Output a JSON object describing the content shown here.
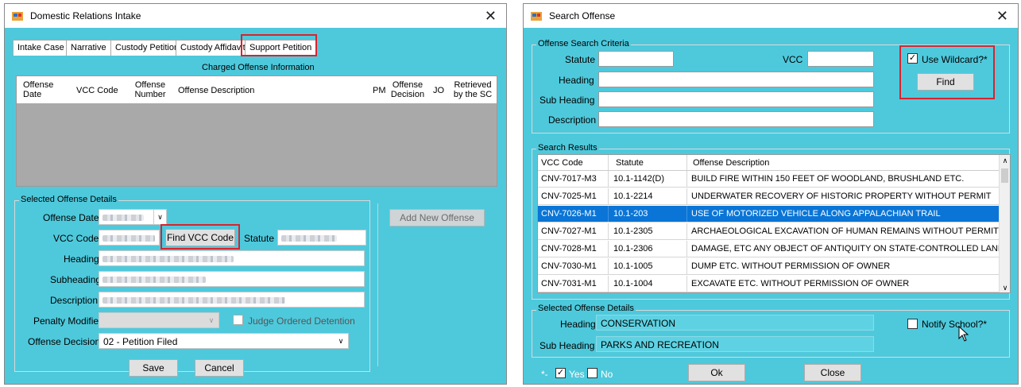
{
  "left_window": {
    "title": "Domestic Relations Intake",
    "tabs": [
      "Intake Case",
      "Narrative",
      "Custody Petition",
      "Custody Affidavit",
      "Support Petition"
    ],
    "grid_title": "Charged Offense Information",
    "columns": [
      "Offense Date",
      "VCC Code",
      "Offense Number",
      "Offense Description",
      "PM",
      "Offense Decision",
      "JO",
      "Retrieved by the SC"
    ],
    "details_group": "Selected Offense Details",
    "labels": {
      "offense_date": "Offense Date",
      "vcc_code": "VCC Code",
      "statute": "Statute",
      "heading": "Heading",
      "subheading": "Subheading",
      "description": "Description",
      "penalty_modifier": "Penalty Modifier",
      "judge_ordered": "Judge Ordered Detention",
      "offense_decision": "Offense Decision"
    },
    "find_vcc_button": "Find VCC Code",
    "add_offense_button": "Add New Offense",
    "offense_decision_value": "02 - Petition Filed",
    "save_button": "Save",
    "cancel_button": "Cancel"
  },
  "right_window": {
    "title": "Search Offense",
    "criteria_group": "Offense Search Criteria",
    "labels": {
      "statute": "Statute",
      "vcc": "VCC",
      "heading": "Heading",
      "sub_heading": "Sub Heading",
      "description": "Description"
    },
    "use_wildcard": "Use Wildcard?*",
    "find_button": "Find",
    "results_group": "Search Results",
    "result_columns": [
      "VCC Code",
      "Statute",
      "Offense Description"
    ],
    "results": [
      {
        "vcc": "CNV-7017-M3",
        "statute": "10.1-1142(D)",
        "desc": "BUILD FIRE WITHIN 150 FEET OF WOODLAND, BRUSHLAND ETC."
      },
      {
        "vcc": "CNV-7025-M1",
        "statute": "10.1-2214",
        "desc": "UNDERWATER RECOVERY OF HISTORIC PROPERTY WITHOUT PERMIT"
      },
      {
        "vcc": "CNV-7026-M1",
        "statute": "10.1-203",
        "desc": "USE OF MOTORIZED VEHICLE ALONG APPALACHIAN TRAIL"
      },
      {
        "vcc": "CNV-7027-M1",
        "statute": "10.1-2305",
        "desc": "ARCHAEOLOGICAL EXCAVATION OF HUMAN REMAINS WITHOUT PERMIT"
      },
      {
        "vcc": "CNV-7028-M1",
        "statute": "10.1-2306",
        "desc": "DAMAGE, ETC ANY OBJECT OF ANTIQUITY ON STATE-CONTROLLED LAND"
      },
      {
        "vcc": "CNV-7030-M1",
        "statute": "10.1-1005",
        "desc": "DUMP ETC. WITHOUT PERMISSION OF OWNER"
      },
      {
        "vcc": "CNV-7031-M1",
        "statute": "10.1-1004",
        "desc": "EXCAVATE ETC. WITHOUT PERMISSION OF OWNER"
      }
    ],
    "selected_row": 2,
    "selected_group": "Selected Offense Details",
    "heading_label": "Heading",
    "heading_value": "CONSERVATION",
    "sub_heading_label": "Sub Heading",
    "sub_heading_value": "PARKS AND RECREATION",
    "notify_school": "Notify School?*",
    "legend_star": "*-",
    "legend_yes": "Yes",
    "legend_no": "No",
    "ok_button": "Ok",
    "close_button": "Close"
  },
  "colors": {
    "window_bg": "#4ec9dc",
    "selection": "#0a75d6",
    "highlight_box": "#d9232d"
  }
}
